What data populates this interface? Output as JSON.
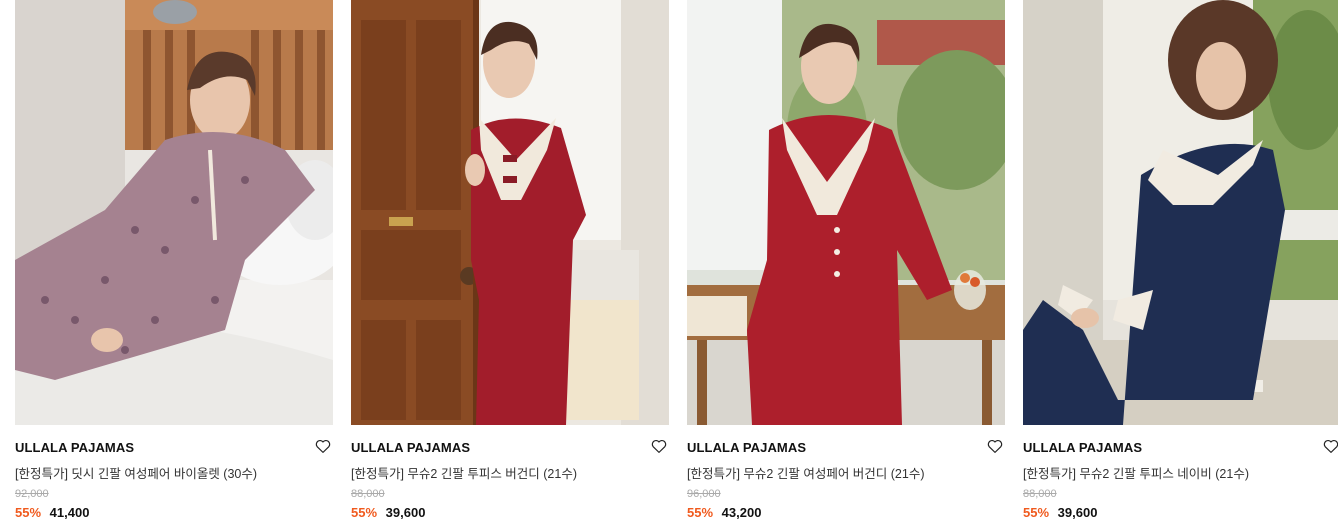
{
  "products": [
    {
      "brand": "ULLALA PAJAMAS",
      "title": "[한정특가] 딧시 긴팔 여성페어 바이올렛 (30수)",
      "original_price": "92,000",
      "discount": "55%",
      "price": "41,400",
      "image": "woman-floral-pajamas-on-bed"
    },
    {
      "brand": "ULLALA PAJAMAS",
      "title": "[한정특가] 무슈2 긴팔 투피스 버건디 (21수)",
      "original_price": "88,000",
      "discount": "55%",
      "price": "39,600",
      "image": "woman-red-pajamas-at-door"
    },
    {
      "brand": "ULLALA PAJAMAS",
      "title": "[한정특가] 무슈2 긴팔 여성페어 버건디 (21수)",
      "original_price": "96,000",
      "discount": "55%",
      "price": "43,200",
      "image": "woman-red-pajamas-on-table"
    },
    {
      "brand": "ULLALA PAJAMAS",
      "title": "[한정특가] 무슈2 긴팔 투피스 네이비 (21수)",
      "original_price": "88,000",
      "discount": "55%",
      "price": "39,600",
      "image": "woman-navy-pajamas-on-chair"
    }
  ],
  "colors": {
    "discount": "#f05a1e",
    "original_price": "#aaaaaa",
    "brand": "#111111"
  },
  "icons": {
    "wishlist": "heart-outline-icon"
  }
}
